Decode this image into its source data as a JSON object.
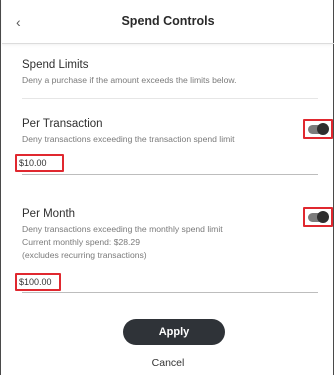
{
  "header": {
    "back_glyph": "‹",
    "title": "Spend Controls"
  },
  "spend_limits": {
    "title": "Spend Limits",
    "description": "Deny a purchase if the amount exceeds the limits below."
  },
  "per_transaction": {
    "title": "Per Transaction",
    "description": "Deny transactions exceeding the transaction spend limit",
    "enabled": true,
    "amount": "$10.00"
  },
  "per_month": {
    "title": "Per Month",
    "description": "Deny transactions exceeding the monthly spend limit",
    "current_spend": "Current monthly spend: $28.29",
    "note": "(excludes recurring transactions)",
    "enabled": true,
    "amount": "$100.00"
  },
  "actions": {
    "apply_label": "Apply",
    "cancel_label": "Cancel"
  },
  "colors": {
    "highlight": "#e0282f",
    "button_bg": "#2f3338",
    "toggle_track": "#7c7c7c",
    "toggle_knob": "#2e2e2e"
  }
}
